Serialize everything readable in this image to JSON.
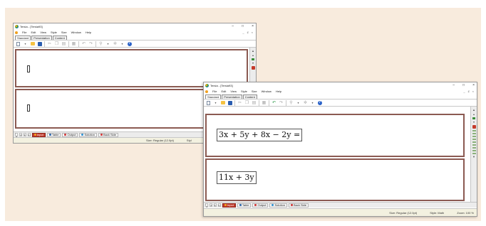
{
  "app": {
    "title": "Tersia - [Tersia93]",
    "window_controls": {
      "minimize": "–",
      "maximize": "□",
      "close": "×"
    },
    "mdi_controls": {
      "minimize": "_",
      "restore": "♯",
      "close": "×"
    }
  },
  "menu": [
    "File",
    "Edit",
    "View",
    "Style",
    "Size",
    "Window",
    "Help"
  ],
  "toolbar_tabs": [
    "Standard",
    "Presentation",
    "Content"
  ],
  "toolbar_icons": [
    "new-icon",
    "open-icon",
    "save-icon",
    "cut-icon",
    "copy-icon",
    "paste-icon",
    "format-icon",
    "undo-icon",
    "redo-icon",
    "zoom-icon",
    "settings-icon",
    "help-icon"
  ],
  "sheet_tabs": [
    {
      "label": "Input",
      "icon": "input-icon",
      "color": "#c0392b",
      "active": true
    },
    {
      "label": "Table",
      "icon": "table-icon",
      "color": "#3a6fb0",
      "active": false
    },
    {
      "label": "Output",
      "icon": "output-icon",
      "color": "#d04040",
      "active": false
    },
    {
      "label": "Solution",
      "icon": "solution-icon",
      "color": "#2c8fd0",
      "active": false
    },
    {
      "label": "Back Side",
      "icon": "back-side-icon",
      "color": "#d04040",
      "active": false
    }
  ],
  "tab_nav": [
    "|◄",
    "◄",
    "►",
    "►|"
  ],
  "back_window": {
    "status": {
      "size": "Size: Regular (12.0pt)",
      "style": "Styl"
    }
  },
  "front_window": {
    "expressions": [
      {
        "label": "expression-1",
        "text": "3x + 5y  +  8x  − 2y ="
      },
      {
        "label": "expression-2",
        "text": "11x + 3y"
      }
    ],
    "status": {
      "size": "Size: Regular (12.0pt)",
      "style": "Style: Math",
      "zoom": "Zoom: 100 %"
    }
  },
  "colors": {
    "backdrop": "#f8ebdd",
    "sheet_border": "#8b5a52",
    "active_tab": "#c0392b",
    "status_bar": "#f3f1e0"
  }
}
